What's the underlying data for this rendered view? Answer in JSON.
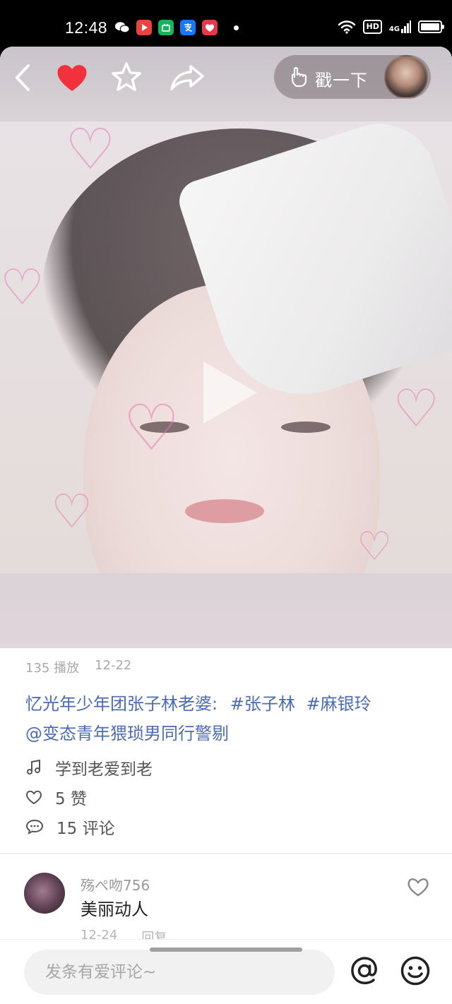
{
  "status_bar": {
    "time": "12:48",
    "hd": "HD",
    "network": "4G"
  },
  "header": {
    "poke_label": "戳一下"
  },
  "video": {
    "play_count": "135 播放",
    "date": "12-22",
    "caption_text": "忆光年少年团张子林老婆:",
    "hashtag_1": "#张子林",
    "hashtag_2": "#麻银玲",
    "mention": "@变态青年猥琐男同行警剔",
    "music": "学到老爱到老",
    "likes": "5 赞",
    "comments": "15 评论"
  },
  "comment": {
    "username": "殇ぺ吻756",
    "text": "美丽动人",
    "time": "12-24",
    "reply_label": "回复"
  },
  "input": {
    "placeholder": "发条有爱评论~"
  },
  "colors": {
    "accent_link": "#4b6bb3",
    "heart_red": "#f1323c"
  }
}
